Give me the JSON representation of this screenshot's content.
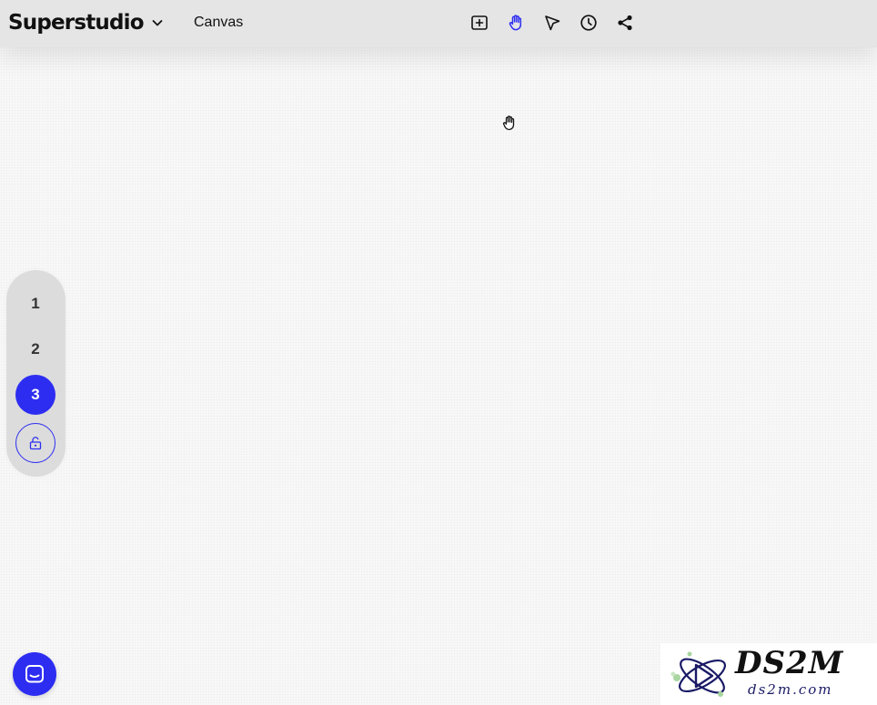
{
  "app": {
    "name": "Superstudio",
    "page_label": "Canvas"
  },
  "toolbar": {
    "tools": [
      {
        "icon": "add-frame-icon",
        "active": false
      },
      {
        "icon": "hand-icon",
        "active": true
      },
      {
        "icon": "pointer-icon",
        "active": false
      },
      {
        "icon": "clock-icon",
        "active": false
      },
      {
        "icon": "share-icon",
        "active": false
      }
    ]
  },
  "pager": {
    "pages": [
      "1",
      "2",
      "3"
    ],
    "active_page": "3",
    "lock_icon": "unlock-icon"
  },
  "chat": {
    "icon": "chat-icon"
  },
  "watermark": {
    "title": "DS2M",
    "url": "ds2m.com"
  },
  "colors": {
    "accent": "#2d2df2",
    "topbar": "#e5e5e5",
    "pager_bg": "#dcdcdc",
    "canvas_bg": "#f7f7f7"
  }
}
